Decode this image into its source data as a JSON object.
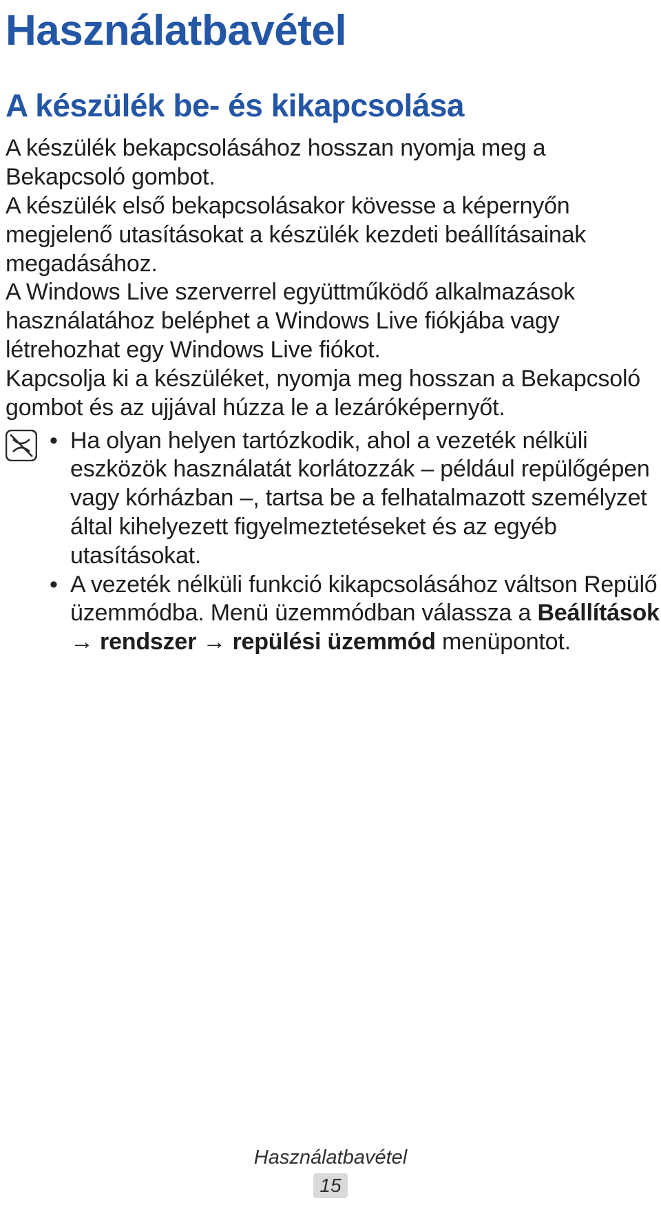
{
  "page": {
    "h1": "Használatbavétel",
    "h2": "A készülék be- és kikapcsolása",
    "p1": "A készülék bekapcsolásához hosszan nyomja meg a Bekapcsoló gombot.",
    "p2": "A készülék első bekapcsolásakor kövesse a képernyőn megjelenő utasításokat a készülék kezdeti beállításainak megadásához.",
    "p3": "A Windows Live szerverrel együttműködő alkalmazások használatához beléphet a Windows Live fiókjába vagy létrehozhat egy Windows Live fiókot.",
    "p4": "Kapcsolja ki a készüléket, nyomja meg hosszan a Bekapcsoló gombot és az ujjával húzza le a lezáróképernyőt.",
    "note": {
      "bullets": [
        {
          "text": "Ha olyan helyen tartózkodik, ahol a vezeték nélküli eszközök használatát korlátozzák – például repülőgépen vagy kórházban –, tartsa be a felhatalmazott személyzet által kihelyezett figyelmeztetéseket és az egyéb utasításokat."
        },
        {
          "prefix": "A vezeték nélküli funkció kikapcsolásához váltson Repülő üzemmódba. Menü üzemmódban válassza a ",
          "bold1": "Beállítások",
          "arrow1": " → ",
          "bold2": "rendszer",
          "arrow2": " → ",
          "bold3": "repülési üzemmód",
          "suffix": " menüpontot."
        }
      ]
    },
    "footer": {
      "section": "Használatbavétel",
      "pagenum": "15"
    }
  }
}
